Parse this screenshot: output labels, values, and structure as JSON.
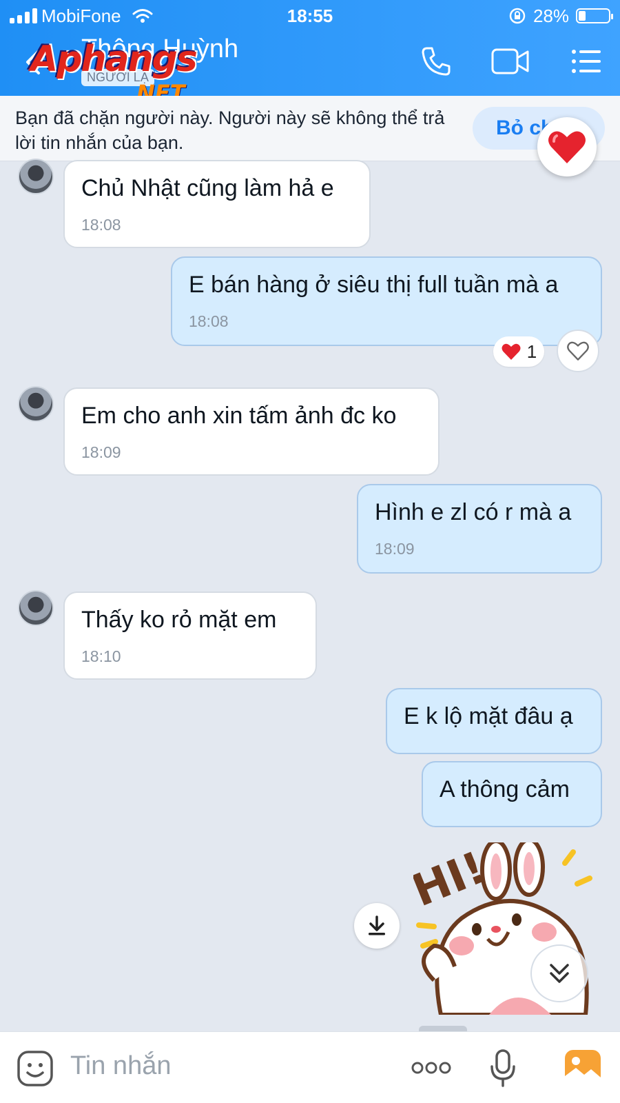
{
  "status_bar": {
    "carrier": "MobiFone",
    "time": "18:55",
    "battery": "28%"
  },
  "header": {
    "back_icon": "chevron-left-icon",
    "contact_name": "Thông Huỳnh",
    "stranger_badge": "NGƯỜI LẠ",
    "watermark_logo": "Aphangs",
    "watermark_suffix": ".NET",
    "actions": [
      "phone-icon",
      "video-call-icon",
      "menu-list-icon"
    ]
  },
  "notice": {
    "text": "Bạn đã chặn người này. Người này sẽ không thể trả lời tin nhắn của bạn.",
    "button_label": "Bỏ chặn"
  },
  "messages": [
    {
      "direction": "in",
      "text": "Chủ Nhật cũng làm hả e",
      "time": "18:08"
    },
    {
      "direction": "out",
      "text": "E bán hàng ở siêu thị full tuần mà a",
      "time": "18:08",
      "reactions": {
        "icon": "heart-icon",
        "count": "1"
      }
    },
    {
      "direction": "in",
      "text": "Em cho anh xin tấm ảnh đc ko",
      "time": "18:09"
    },
    {
      "direction": "out",
      "text": "Hình e zl có r mà a",
      "time": "18:09"
    },
    {
      "direction": "in",
      "text": "Thấy ko rỏ mặt em",
      "time": "18:10"
    },
    {
      "direction": "out",
      "text": "E k lộ mặt đâu ạ",
      "time": ""
    },
    {
      "direction": "out",
      "text": "A thông cảm",
      "time": ""
    }
  ],
  "sticker": {
    "label": "HI!"
  },
  "composer": {
    "placeholder": "Tin nhắn"
  },
  "colors": {
    "header": "#2a96f8",
    "outgoing_bubble": "#d5ecfe",
    "incoming_bubble": "#ffffff",
    "background": "#e3e8f0",
    "accent": "#1a7ef2"
  }
}
